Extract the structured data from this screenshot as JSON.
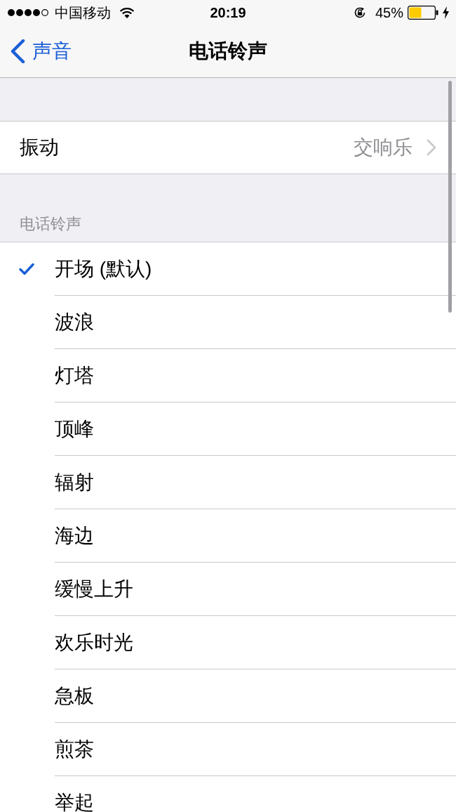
{
  "status_bar": {
    "carrier": "中国移动",
    "time": "20:19",
    "battery": "45%"
  },
  "nav_bar": {
    "back": "声音",
    "title": "电话铃声"
  },
  "settings": [
    {
      "label": "振动",
      "value": "交响乐"
    }
  ],
  "ringtones": {
    "header": "电话铃声",
    "items": [
      {
        "name": "开场 (默认)",
        "selected": true
      },
      {
        "name": "波浪",
        "selected": false
      },
      {
        "name": "灯塔",
        "selected": false
      },
      {
        "name": "顶峰",
        "selected": false
      },
      {
        "name": "辐射",
        "selected": false
      },
      {
        "name": "海边",
        "selected": false
      },
      {
        "name": "缓慢上升",
        "selected": false
      },
      {
        "name": "欢乐时光",
        "selected": false
      },
      {
        "name": "急板",
        "selected": false
      },
      {
        "name": "煎茶",
        "selected": false
      },
      {
        "name": "举起",
        "selected": false
      }
    ]
  }
}
